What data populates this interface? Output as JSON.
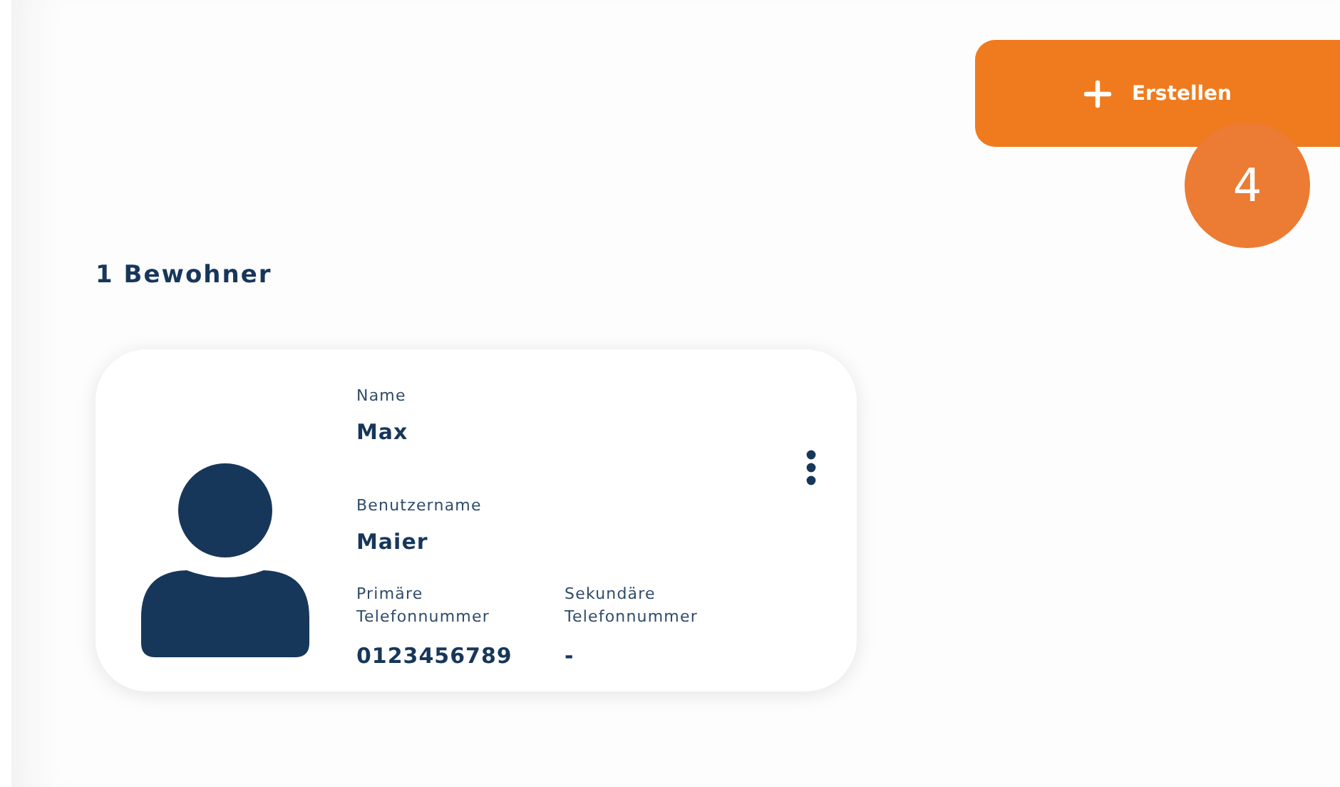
{
  "create_button": {
    "label": "Erstellen"
  },
  "step_badge": "4",
  "heading": "1 Bewohner",
  "residents": [
    {
      "name_label": "Name",
      "name": "Max",
      "username_label": "Benutzername",
      "username": "Maier",
      "primary_phone_label": "Primäre Telefonnummer",
      "primary_phone": "0123456789",
      "secondary_phone_label": "Sekundäre Telefonnummer",
      "secondary_phone": "-"
    }
  ]
}
